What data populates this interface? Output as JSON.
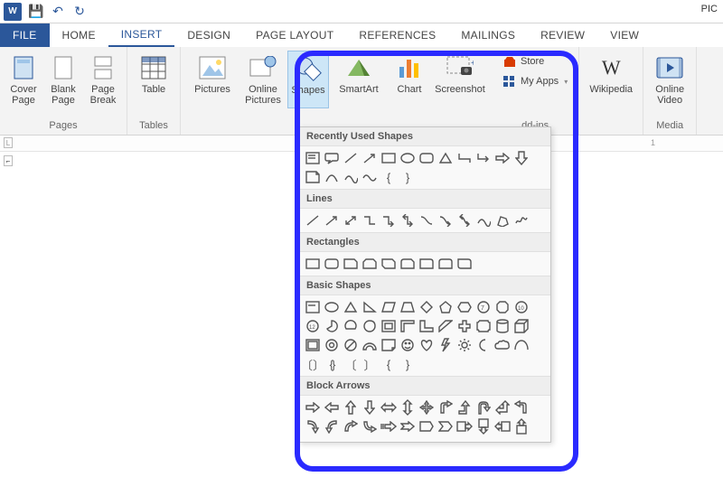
{
  "titlebar": {
    "pic_label": "PIC"
  },
  "tabs": {
    "file": "FILE",
    "home": "HOME",
    "insert": "INSERT",
    "design": "DESIGN",
    "page_layout": "PAGE LAYOUT",
    "references": "REFERENCES",
    "mailings": "MAILINGS",
    "review": "REVIEW",
    "view": "VIEW"
  },
  "ribbon": {
    "pages": {
      "cover_page": "Cover\nPage",
      "blank_page": "Blank\nPage",
      "page_break": "Page\nBreak",
      "caption": "Pages"
    },
    "tables": {
      "table": "Table",
      "caption": "Tables"
    },
    "illustrations": {
      "pictures": "Pictures",
      "online_pictures": "Online\nPictures",
      "shapes": "Shapes",
      "smartart": "SmartArt",
      "chart": "Chart",
      "screenshot": "Screenshot"
    },
    "addins": {
      "store": "Store",
      "my_apps": "My Apps",
      "wikipedia": "Wikipedia",
      "caption": "dd-ins"
    },
    "media": {
      "online_video": "Online\nVideo",
      "caption": "Media"
    }
  },
  "ruler": {
    "tick1": "1"
  },
  "shapes_gallery": {
    "sections": {
      "recently_used": "Recently Used Shapes",
      "lines": "Lines",
      "rectangles": "Rectangles",
      "basic_shapes": "Basic Shapes",
      "block_arrows": "Block Arrows"
    }
  }
}
